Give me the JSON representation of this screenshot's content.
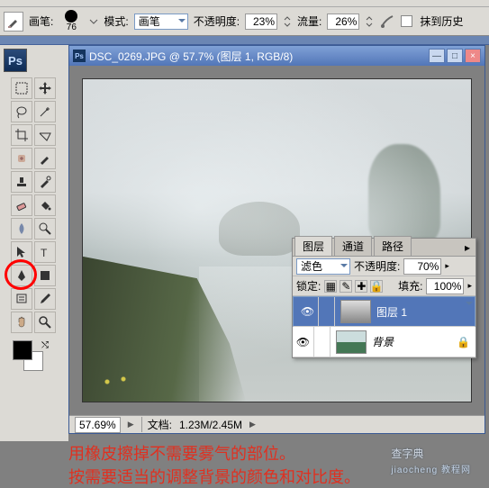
{
  "optionbar": {
    "brush_label": "画笔:",
    "brush_size": "76",
    "mode_label": "模式:",
    "mode_value": "画笔",
    "opacity_label": "不透明度:",
    "opacity_value": "23%",
    "flow_label": "流量:",
    "flow_value": "26%",
    "history_label": "抹到历史"
  },
  "document": {
    "title": "DSC_0269.JPG @ 57.7% (图层 1, RGB/8)",
    "zoom": "57.69%",
    "docinfo_label": "文档:",
    "docinfo_value": "1.23M/2.45M"
  },
  "layers_panel": {
    "tabs": {
      "layers": "图层",
      "channels": "通道",
      "paths": "路径"
    },
    "blend_value": "滤色",
    "opacity_label": "不透明度:",
    "opacity_value": "70%",
    "lock_label": "锁定:",
    "fill_label": "填充:",
    "fill_value": "100%",
    "items": [
      {
        "name": "图层 1"
      },
      {
        "name": "背景"
      }
    ]
  },
  "captions": {
    "line1": "用橡皮擦掉不需要雾气的部位。",
    "line2": "按需要适当的调整背景的颜色和对比度。"
  },
  "watermark": {
    "main": "查字典",
    "sub": "jiaocheng 教程网"
  },
  "icons": {
    "min": "—",
    "max": "□",
    "close": "×",
    "arrow": "▶",
    "eye": "👁",
    "checker": "▦",
    "brush": "✎",
    "lock": "🔒",
    "plus": "✚"
  }
}
